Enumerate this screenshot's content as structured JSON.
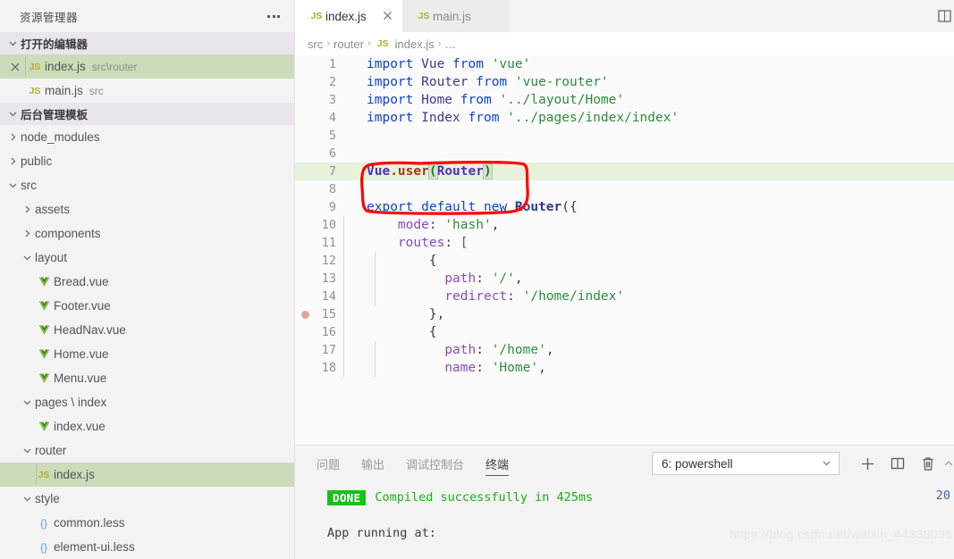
{
  "sidebar": {
    "header_title": "资源管理器",
    "more_icon": "ellipsis-icon",
    "open_editors": {
      "label": "打开的编辑器",
      "items": [
        {
          "icon": "js-file-icon",
          "name": "index.js",
          "sub": "src\\router",
          "selected": true,
          "closable": true
        },
        {
          "icon": "js-file-icon",
          "name": "main.js",
          "sub": "src",
          "selected": false,
          "closable": false
        }
      ]
    },
    "project": {
      "label": "后台管理模板",
      "tree": [
        {
          "name": "node_modules",
          "type": "folder",
          "expanded": false,
          "depth": 1
        },
        {
          "name": "public",
          "type": "folder",
          "expanded": false,
          "depth": 1
        },
        {
          "name": "src",
          "type": "folder",
          "expanded": true,
          "depth": 1
        },
        {
          "name": "assets",
          "type": "folder",
          "expanded": false,
          "depth": 2
        },
        {
          "name": "components",
          "type": "folder",
          "expanded": false,
          "depth": 2
        },
        {
          "name": "layout",
          "type": "folder",
          "expanded": true,
          "depth": 2
        },
        {
          "name": "Bread.vue",
          "type": "vue",
          "depth": 3
        },
        {
          "name": "Footer.vue",
          "type": "vue",
          "depth": 3
        },
        {
          "name": "HeadNav.vue",
          "type": "vue",
          "depth": 3
        },
        {
          "name": "Home.vue",
          "type": "vue",
          "depth": 3
        },
        {
          "name": "Menu.vue",
          "type": "vue",
          "depth": 3
        },
        {
          "name": "pages \\ index",
          "type": "folder",
          "expanded": true,
          "depth": 2
        },
        {
          "name": "index.vue",
          "type": "vue",
          "depth": 3
        },
        {
          "name": "router",
          "type": "folder",
          "expanded": true,
          "depth": 2
        },
        {
          "name": "index.js",
          "type": "js",
          "depth": 3,
          "selected": true
        },
        {
          "name": "style",
          "type": "folder",
          "expanded": true,
          "depth": 2
        },
        {
          "name": "common.less",
          "type": "less",
          "depth": 3
        },
        {
          "name": "element-ui.less",
          "type": "less",
          "depth": 3
        }
      ]
    }
  },
  "editor": {
    "tabs": [
      {
        "label": "index.js",
        "icon": "js-file-icon",
        "active": true,
        "closable": true
      },
      {
        "label": "main.js",
        "icon": "js-file-icon",
        "active": false,
        "closable": false
      }
    ],
    "split_editor_icon": "split-editor-icon",
    "breadcrumb": [
      "src",
      "router",
      "index.js",
      "…"
    ],
    "breadcrumb_file_icon": "js-file-icon",
    "annotation_color": "#ff0000",
    "highlight_line": 7,
    "breakpoint_line": 15,
    "lines": [
      {
        "n": 1,
        "tokens": [
          {
            "t": "import",
            "c": "k-import"
          },
          {
            "t": " Vue ",
            "c": "k-var"
          },
          {
            "t": "from",
            "c": "k-import"
          },
          {
            "t": " ",
            "c": "k-plain"
          },
          {
            "t": "'vue'",
            "c": "k-str"
          }
        ]
      },
      {
        "n": 2,
        "tokens": [
          {
            "t": "import",
            "c": "k-import"
          },
          {
            "t": " Router ",
            "c": "k-var"
          },
          {
            "t": "from",
            "c": "k-import"
          },
          {
            "t": " ",
            "c": "k-plain"
          },
          {
            "t": "'vue-router'",
            "c": "k-str"
          }
        ]
      },
      {
        "n": 3,
        "tokens": [
          {
            "t": "import",
            "c": "k-import"
          },
          {
            "t": " Home ",
            "c": "k-var"
          },
          {
            "t": "from",
            "c": "k-import"
          },
          {
            "t": " ",
            "c": "k-plain"
          },
          {
            "t": "'../layout/Home'",
            "c": "k-str"
          }
        ]
      },
      {
        "n": 4,
        "tokens": [
          {
            "t": "import",
            "c": "k-import"
          },
          {
            "t": " Index ",
            "c": "k-var"
          },
          {
            "t": "from",
            "c": "k-import"
          },
          {
            "t": " ",
            "c": "k-plain"
          },
          {
            "t": "'../pages/index/index'",
            "c": "k-str"
          }
        ]
      },
      {
        "n": 5,
        "tokens": []
      },
      {
        "n": 6,
        "tokens": []
      },
      {
        "n": 7,
        "tokens": [
          {
            "t": "Vue",
            "c": "k-obj"
          },
          {
            "t": ".user",
            "c": "k-meth"
          },
          {
            "t": "__CURSOR__",
            "c": ""
          },
          {
            "t": "(",
            "c": "k-paren brk-match"
          },
          {
            "t": "Router",
            "c": "k-obj"
          },
          {
            "t": ")",
            "c": "k-paren brk-match"
          }
        ]
      },
      {
        "n": 8,
        "tokens": []
      },
      {
        "n": 9,
        "tokens": [
          {
            "t": "export default",
            "c": "k-import"
          },
          {
            "t": " ",
            "c": "k-plain"
          },
          {
            "t": "new",
            "c": "k-import"
          },
          {
            "t": " ",
            "c": "k-plain"
          },
          {
            "t": "Router",
            "c": "k-class"
          },
          {
            "t": "({",
            "c": "k-plain"
          }
        ]
      },
      {
        "n": 10,
        "tokens": [
          {
            "t": "    ",
            "c": "k-plain"
          },
          {
            "t": "mode",
            "c": "k-prop"
          },
          {
            "t": ": ",
            "c": "k-plain"
          },
          {
            "t": "'hash'",
            "c": "k-str"
          },
          {
            "t": ",",
            "c": "k-plain"
          }
        ]
      },
      {
        "n": 11,
        "tokens": [
          {
            "t": "    ",
            "c": "k-plain"
          },
          {
            "t": "routes",
            "c": "k-prop"
          },
          {
            "t": ": ",
            "c": "k-plain"
          },
          {
            "t": "[",
            "c": "k-kw"
          }
        ]
      },
      {
        "n": 12,
        "tokens": [
          {
            "t": "        ",
            "c": "k-plain"
          },
          {
            "t": "{",
            "c": "k-plain"
          }
        ]
      },
      {
        "n": 13,
        "tokens": [
          {
            "t": "          ",
            "c": "k-plain"
          },
          {
            "t": "path",
            "c": "k-prop"
          },
          {
            "t": ": ",
            "c": "k-plain"
          },
          {
            "t": "'/'",
            "c": "k-str"
          },
          {
            "t": ",",
            "c": "k-plain"
          }
        ]
      },
      {
        "n": 14,
        "tokens": [
          {
            "t": "          ",
            "c": "k-plain"
          },
          {
            "t": "redirect",
            "c": "k-prop"
          },
          {
            "t": ": ",
            "c": "k-plain"
          },
          {
            "t": "'/home/index'",
            "c": "k-str"
          }
        ]
      },
      {
        "n": 15,
        "tokens": [
          {
            "t": "        ",
            "c": "k-plain"
          },
          {
            "t": "},",
            "c": "k-plain"
          }
        ]
      },
      {
        "n": 16,
        "tokens": [
          {
            "t": "        ",
            "c": "k-plain"
          },
          {
            "t": "{",
            "c": "k-plain"
          }
        ]
      },
      {
        "n": 17,
        "tokens": [
          {
            "t": "          ",
            "c": "k-plain"
          },
          {
            "t": "path",
            "c": "k-prop"
          },
          {
            "t": ": ",
            "c": "k-plain"
          },
          {
            "t": "'/home'",
            "c": "k-str"
          },
          {
            "t": ",",
            "c": "k-plain"
          }
        ]
      },
      {
        "n": 18,
        "tokens": [
          {
            "t": "          ",
            "c": "k-plain"
          },
          {
            "t": "name",
            "c": "k-prop"
          },
          {
            "t": ": ",
            "c": "k-plain"
          },
          {
            "t": "'Home'",
            "c": "k-str"
          },
          {
            "t": ",",
            "c": "k-plain"
          }
        ]
      }
    ]
  },
  "panel": {
    "tabs": [
      {
        "label": "问题",
        "active": false
      },
      {
        "label": "输出",
        "active": false
      },
      {
        "label": "调试控制台",
        "active": false
      },
      {
        "label": "终端",
        "active": true
      }
    ],
    "terminal_select": {
      "value": "6: powershell",
      "chevron_icon": "chevron-down-icon"
    },
    "actions": [
      {
        "icon": "plus-icon",
        "name": "new-terminal-button"
      },
      {
        "icon": "split-panel-icon",
        "name": "split-terminal-button"
      },
      {
        "icon": "trash-icon",
        "name": "kill-terminal-button"
      },
      {
        "icon": "chevron-up-icon",
        "name": "maximize-panel-button"
      }
    ],
    "terminal_output": {
      "badge": "DONE",
      "badge_color": "#18c018",
      "message": "Compiled successfully in 425ms",
      "time": "20",
      "line2": "App running at:"
    }
  },
  "watermark": "https://blog.csdn.net/weixin_44338096"
}
